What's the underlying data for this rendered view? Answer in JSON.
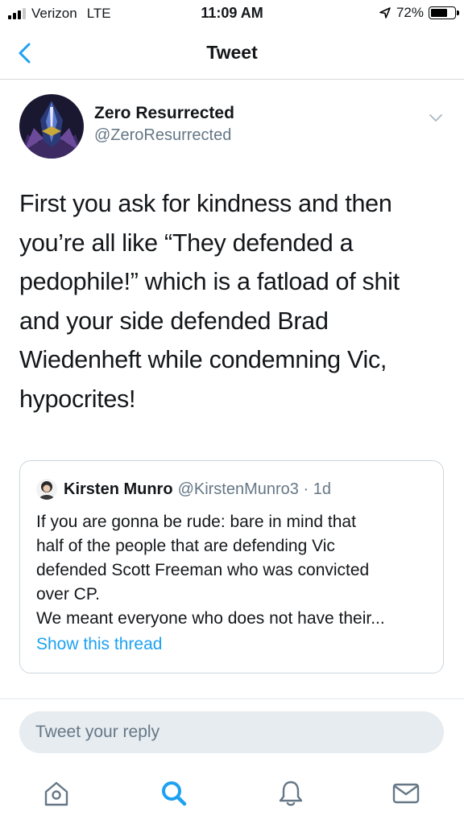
{
  "status_bar": {
    "carrier": "Verizon",
    "network": "LTE",
    "time": "11:09 AM",
    "battery_percent": "72%",
    "battery_level": 0.72,
    "signal_bars": 3
  },
  "nav": {
    "title": "Tweet",
    "back_icon": "chevron-left-icon"
  },
  "tweet": {
    "author_name": "Zero Resurrected",
    "author_handle": "@ZeroResurrected",
    "lines": [
      "First you ask for kindness and then",
      "you’re all like “They defended a",
      "pedophile!” which is a fatload of shit",
      "and your side defended Brad",
      "Wiedenheft while condemning Vic,",
      "hypocrites!"
    ]
  },
  "quote": {
    "author_name": "Kirsten Munro",
    "author_handle": "@KirstenMunro3 · 1d",
    "lines": [
      "If you are gonna be rude: bare in mind that",
      "half of the people that are defending Vic",
      "defended Scott Freeman who was convicted",
      "over CP.",
      "We meant everyone who does not have their..."
    ],
    "show_thread": "Show this thread"
  },
  "reply": {
    "placeholder": "Tweet your reply"
  },
  "tabs": [
    "home-icon",
    "search-icon",
    "notifications-icon",
    "messages-icon"
  ],
  "colors": {
    "link": "#1da1f2",
    "secondary_text": "#657786",
    "border": "#ccd6dd"
  }
}
